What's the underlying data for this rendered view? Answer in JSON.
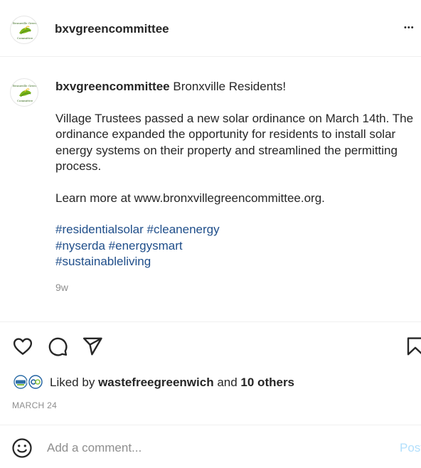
{
  "post": {
    "username": "bxvgreencommittee",
    "more_label": "•••",
    "avatar_text": [
      "Bronxville Green",
      "Committee"
    ]
  },
  "caption": {
    "username": "bxvgreencommittee",
    "headline": "Bronxville Residents!",
    "paragraph1": "Village Trustees passed a new solar ordinance on March 14th. The ordinance expanded the opportunity for residents to install solar energy systems on their property and streamlined the permitting process.",
    "paragraph2": "Learn more at www.bronxvillegreencommittee.org.",
    "hashtags_line1": "#residentialsolar #cleanenergy",
    "hashtags_line2": "#nyserda #energysmart",
    "hashtags_line3": "#sustainableliving",
    "time_ago": "9w"
  },
  "actions": {
    "like_icon": "heart-icon",
    "comment_icon": "speech-bubble-icon",
    "share_icon": "paper-plane-icon",
    "save_icon": "bookmark-icon"
  },
  "likes": {
    "prefix": "Liked by",
    "user": "wastefreegreenwich",
    "middle": "and",
    "others": "10 others"
  },
  "date": "MARCH 24",
  "comment_box": {
    "placeholder": "Add a comment...",
    "post_label": "Post"
  },
  "colors": {
    "text": "#262626",
    "secondary": "#8e8e8e",
    "hashtag": "#1f4e8a",
    "post_disabled": "#b2dffc",
    "logo_green": "#7cb518"
  }
}
